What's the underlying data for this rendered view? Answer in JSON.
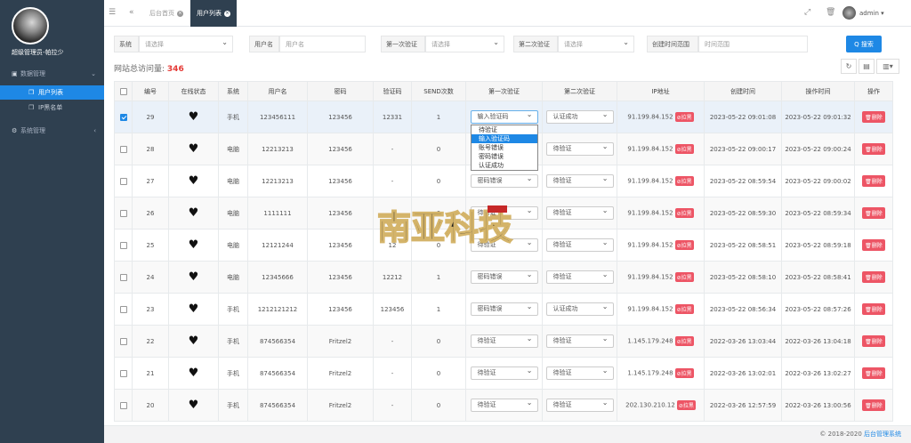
{
  "sidebar": {
    "username": "超级管理员-帕拉少",
    "menu": [
      {
        "label": "数据管理",
        "icon": "database-icon",
        "expanded": true
      },
      {
        "label": "系统管理",
        "icon": "gears-icon",
        "expanded": false
      }
    ],
    "submenu": [
      {
        "label": "用户列表",
        "active": true
      },
      {
        "label": "IP黑名单",
        "active": false
      }
    ]
  },
  "topbar": {
    "tabs": [
      {
        "label": "后台首页"
      },
      {
        "label": "用户列表",
        "active": true
      }
    ],
    "admin": "admin ▾"
  },
  "filters": {
    "system_label": "系统",
    "system_value": "请选择",
    "username_label": "用户名",
    "username_placeholder": "用户名",
    "first_verify_label": "第一次验证",
    "first_verify_value": "请选择",
    "second_verify_label": "第二次验证",
    "second_verify_value": "请选择",
    "time_label": "创建时间范围",
    "time_placeholder": "时间范围",
    "search_button": "Q 搜索"
  },
  "visit": {
    "label": "网站总访问量:",
    "count": "346"
  },
  "table": {
    "headers": [
      "编号",
      "在线状态",
      "系统",
      "用户名",
      "密码",
      "验证码",
      "SEND次数",
      "第一次验证",
      "第二次验证",
      "IP地址",
      "创建时间",
      "操作时间",
      "操作"
    ],
    "rows": [
      {
        "id": "29",
        "sys": "手机",
        "user": "123456111",
        "pwd": "123456",
        "code": "12331",
        "send": "1",
        "v1": "输入验证码",
        "v2": "认证成功",
        "ip": "91.199.84.152",
        "created": "2023-05-22 09:01:08",
        "op": "2023-05-22 09:01:32",
        "checked": true
      },
      {
        "id": "28",
        "sys": "电脑",
        "user": "12213213",
        "pwd": "123456",
        "code": "-",
        "send": "0",
        "v1": "待验证",
        "v2": "待验证",
        "ip": "91.199.84.152",
        "created": "2023-05-22 09:00:17",
        "op": "2023-05-22 09:00:24",
        "checked": false
      },
      {
        "id": "27",
        "sys": "电脑",
        "user": "12213213",
        "pwd": "123456",
        "code": "-",
        "send": "0",
        "v1": "密码错误",
        "v2": "待验证",
        "ip": "91.199.84.152",
        "created": "2023-05-22 08:59:54",
        "op": "2023-05-22 09:00:02",
        "checked": false
      },
      {
        "id": "26",
        "sys": "电脑",
        "user": "1111111",
        "pwd": "123456",
        "code": "-",
        "send": "0",
        "v1": "待验证",
        "v2": "待验证",
        "ip": "91.199.84.152",
        "created": "2023-05-22 08:59:30",
        "op": "2023-05-22 08:59:34",
        "checked": false
      },
      {
        "id": "25",
        "sys": "电脑",
        "user": "12121244",
        "pwd": "123456",
        "code": "12",
        "send": "0",
        "v1": "待验证",
        "v2": "待验证",
        "ip": "91.199.84.152",
        "created": "2023-05-22 08:58:51",
        "op": "2023-05-22 08:59:18",
        "checked": false
      },
      {
        "id": "24",
        "sys": "电脑",
        "user": "12345666",
        "pwd": "123456",
        "code": "12212",
        "send": "1",
        "v1": "密码错误",
        "v2": "待验证",
        "ip": "91.199.84.152",
        "created": "2023-05-22 08:58:10",
        "op": "2023-05-22 08:58:41",
        "checked": false
      },
      {
        "id": "23",
        "sys": "手机",
        "user": "1212121212",
        "pwd": "123456",
        "code": "123456",
        "send": "1",
        "v1": "密码错误",
        "v2": "认证成功",
        "ip": "91.199.84.152",
        "created": "2023-05-22 08:56:34",
        "op": "2023-05-22 08:57:26",
        "checked": false
      },
      {
        "id": "22",
        "sys": "手机",
        "user": "874566354",
        "pwd": "Fritzel2",
        "code": "-",
        "send": "0",
        "v1": "待验证",
        "v2": "待验证",
        "ip": "1.145.179.248",
        "created": "2022-03-26 13:03:44",
        "op": "2022-03-26 13:04:18",
        "checked": false
      },
      {
        "id": "21",
        "sys": "手机",
        "user": "874566354",
        "pwd": "Fritzel2",
        "code": "-",
        "send": "0",
        "v1": "待验证",
        "v2": "待验证",
        "ip": "1.145.179.248",
        "created": "2022-03-26 13:02:01",
        "op": "2022-03-26 13:02:27",
        "checked": false
      },
      {
        "id": "20",
        "sys": "手机",
        "user": "874566354",
        "pwd": "Fritzel2",
        "code": "-",
        "send": "0",
        "v1": "待验证",
        "v2": "待验证",
        "ip": "202.130.210.12",
        "created": "2022-03-26 12:57:59",
        "op": "2022-03-26 13:00:56",
        "checked": false
      }
    ],
    "ban_label": "拉黑",
    "delete_label": "删除"
  },
  "dropdown": {
    "options": [
      "待验证",
      "输入验证码",
      "账号错误",
      "密码错误",
      "认证成功"
    ],
    "highlighted": 1
  },
  "watermark": "南亚科技",
  "footer": {
    "copyright": "© 2018-2020 ",
    "brand": "后台管理系统"
  },
  "colors": {
    "sidebar": "#2f4050",
    "accent": "#1e88e5",
    "danger": "#ed5565"
  }
}
